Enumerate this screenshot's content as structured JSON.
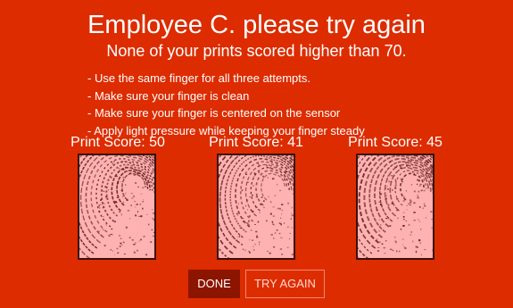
{
  "header": {
    "title": "Employee C. please try again",
    "subtitle": "None of your prints scored higher than 70."
  },
  "tips": [
    "- Use the same finger for all three attempts.",
    "- Make sure your finger is clean",
    "- Make sure your finger is centered on the sensor",
    "- Apply light pressure while keeping your finger steady"
  ],
  "prints": [
    {
      "label": "Print Score: 50",
      "score": 50
    },
    {
      "label": "Print Score: 41",
      "score": 41
    },
    {
      "label": "Print Score: 45",
      "score": 45
    }
  ],
  "buttons": {
    "done": "DONE",
    "try_again": "TRY AGAIN"
  },
  "colors": {
    "background": "#dd2c00",
    "print_bg": "#ffb2b2",
    "print_ink": "#5a1a14",
    "done_bg": "#8c1500"
  }
}
